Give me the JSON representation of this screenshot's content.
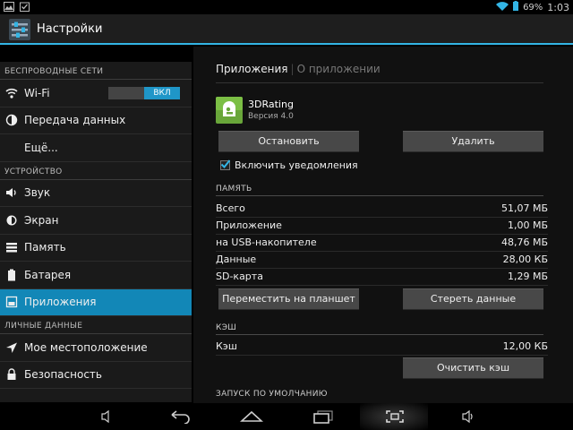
{
  "status_bar": {
    "battery_percent": "69%",
    "clock": "1:03",
    "icons": [
      "image-icon",
      "clipboard-icon",
      "wifi-icon",
      "battery-icon"
    ]
  },
  "action_bar": {
    "title": "Настройки",
    "icon": "settings-sliders-icon"
  },
  "sidebar": {
    "sections": [
      {
        "header": "БЕСПРОВОДНЫЕ СЕТИ",
        "items": [
          {
            "label": "Wi-Fi",
            "icon": "wifi-icon",
            "toggle": "ВКЛ"
          },
          {
            "label": "Передача данных",
            "icon": "data-usage-icon"
          },
          {
            "label": "Ещё..."
          }
        ]
      },
      {
        "header": "УСТРОЙСТВО",
        "items": [
          {
            "label": "Звук",
            "icon": "volume-icon"
          },
          {
            "label": "Экран",
            "icon": "brightness-icon"
          },
          {
            "label": "Память",
            "icon": "storage-icon"
          },
          {
            "label": "Батарея",
            "icon": "battery-icon"
          },
          {
            "label": "Приложения",
            "icon": "apps-icon",
            "selected": true
          }
        ]
      },
      {
        "header": "ЛИЧНЫЕ ДАННЫЕ",
        "items": [
          {
            "label": "Мое местоположение",
            "icon": "location-icon"
          },
          {
            "label": "Безопасность",
            "icon": "lock-icon"
          }
        ]
      }
    ]
  },
  "content": {
    "breadcrumb": {
      "current": "Приложения",
      "next": "О приложении"
    },
    "app": {
      "name": "3DRating",
      "version": "Версия 4.0"
    },
    "buttons": {
      "stop": "Остановить",
      "uninstall": "Удалить",
      "move": "Переместить на планшет",
      "clear_data": "Стереть данные",
      "clear_cache": "Очистить кэш"
    },
    "notifications": {
      "label": "Включить уведомления",
      "checked": true
    },
    "memory": {
      "title": "ПАМЯТЬ",
      "rows": [
        {
          "label": "Всего",
          "value": "51,07 МБ"
        },
        {
          "label": "Приложение",
          "value": "1,00 МБ"
        },
        {
          "label": "на USB-накопителе",
          "value": "48,76 МБ"
        },
        {
          "label": "Данные",
          "value": "28,00 КБ"
        },
        {
          "label": "SD-карта",
          "value": "1,29 МБ"
        }
      ]
    },
    "cache": {
      "title": "КЭШ",
      "rows": [
        {
          "label": "Кэш",
          "value": "12,00 КБ"
        }
      ]
    },
    "launch_default": {
      "title": "ЗАПУСК ПО УМОЛЧАНИЮ"
    }
  },
  "nav_bar": {
    "icons": [
      "volume-down-icon",
      "back-icon",
      "home-icon",
      "recent-apps-icon",
      "screenshot-icon",
      "volume-up-icon"
    ]
  },
  "colors": {
    "accent": "#33b5e5",
    "selected": "#1287b7"
  }
}
